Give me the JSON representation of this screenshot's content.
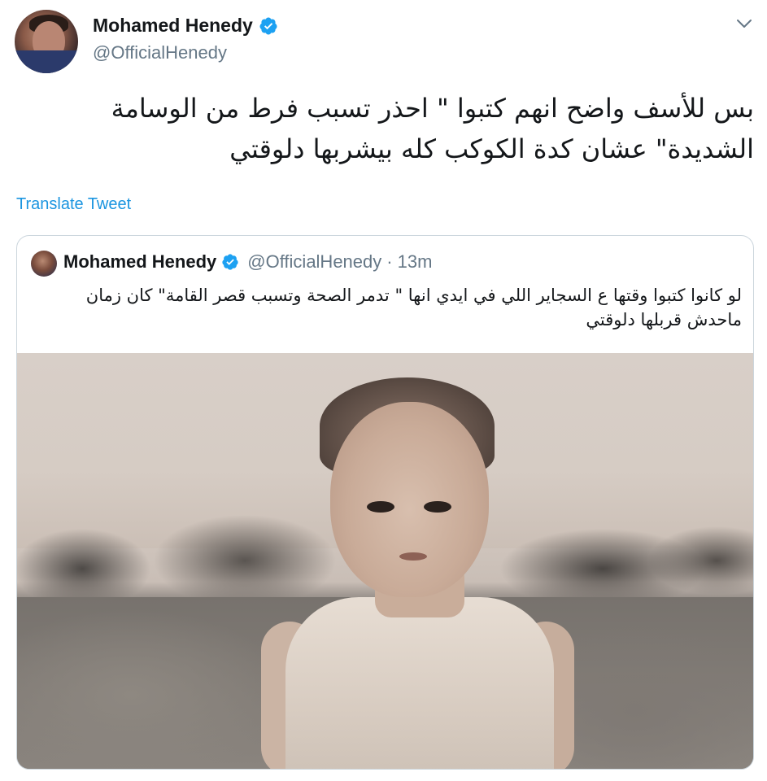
{
  "author": {
    "name": "Mohamed Henedy",
    "handle": "@OfficialHenedy"
  },
  "tweet": {
    "text": "بس للأسف واضح انهم كتبوا \" احذر تسبب فرط من الوسامة الشديدة\" عشان كدة الكوكب كله بيشربها دلوقتي",
    "translate_label": "Translate Tweet"
  },
  "quoted": {
    "name": "Mohamed Henedy",
    "handle": "@OfficialHenedy",
    "separator": "·",
    "time": "13m",
    "text": "لو كانوا كتبوا وقتها ع السجاير اللي في ايدي انها \" تدمر الصحة وتسبب قصر القامة\" كان زمان ماحدش قربلها دلوقتي"
  },
  "colors": {
    "verified_blue": "#1da1f2",
    "link_blue": "#1b95e0",
    "secondary_text": "#657786"
  },
  "icons": {
    "verified": "verified-badge-icon",
    "more": "chevron-down-icon"
  }
}
